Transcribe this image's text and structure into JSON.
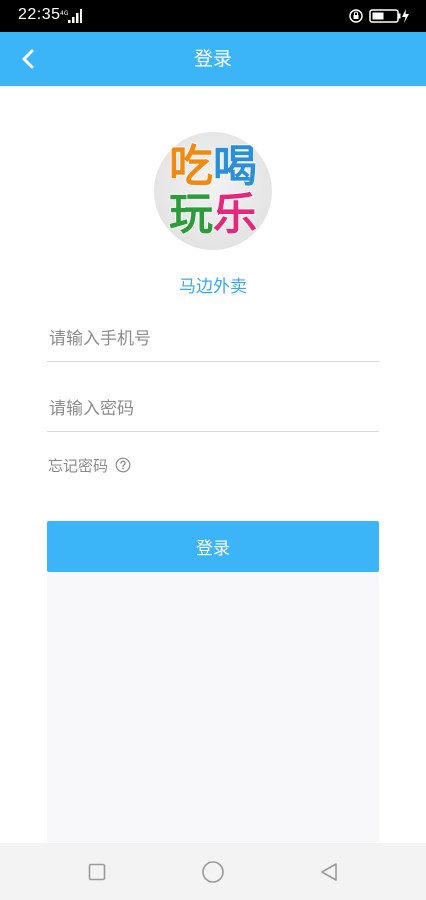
{
  "status_bar": {
    "time": "22:35",
    "network": "4G"
  },
  "header": {
    "title": "登录"
  },
  "logo": {
    "chars": [
      {
        "char": "吃",
        "color": "#f28a12"
      },
      {
        "char": "喝",
        "color": "#2a8fd8"
      },
      {
        "char": "玩",
        "color": "#2e9b3a"
      },
      {
        "char": "乐",
        "color": "#e6267a"
      }
    ]
  },
  "app_name": "马边外卖",
  "form": {
    "phone_placeholder": "请输入手机号",
    "phone_value": "",
    "password_placeholder": "请输入密码",
    "password_value": "",
    "forgot_label": "忘记密码",
    "login_label": "登录"
  },
  "colors": {
    "accent": "#3cb4f8",
    "app_name": "#38a9e8"
  }
}
